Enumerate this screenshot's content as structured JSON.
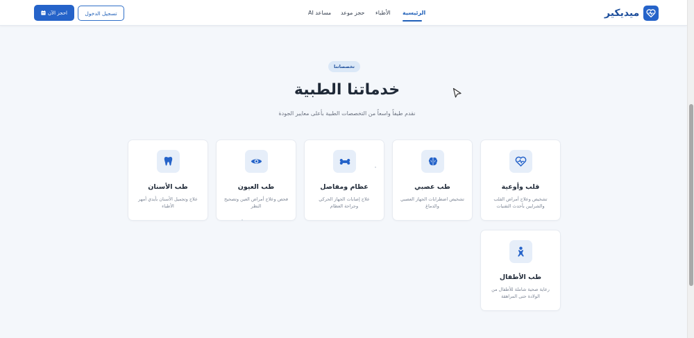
{
  "header": {
    "brand_name": "ميديكير",
    "nav": [
      "الرئيسية",
      "الأطباء",
      "حجز موعد",
      "مساعد AI"
    ],
    "login_label": "تسجيل الدخول",
    "book_label": "احجز الآن"
  },
  "section": {
    "pill": "تخصصاتنا",
    "title": "خدماتنا الطبية",
    "subtitle": "نقدم طيفاً واسعاً من التخصصات الطبية بأعلى معايير الجودة"
  },
  "cards": [
    {
      "title": "قلب وأوعية",
      "desc": "تشخيص وعلاج أمراض القلب والشرايين بأحدث التقنيات",
      "icon": "heart-pulse-icon"
    },
    {
      "title": "طب عصبي",
      "desc": "تشخيص اضطرابات الجهاز العصبي والدماغ",
      "icon": "brain-icon"
    },
    {
      "title": "عظام ومفاصل",
      "desc": "علاج إصابات الجهاز الحركي وجراحة العظام",
      "icon": "bone-icon"
    },
    {
      "title": "طب العيون",
      "desc": "فحص وعلاج أمراض العين وتصحيح النظر",
      "icon": "eye-icon"
    },
    {
      "title": "طب الأسنان",
      "desc": "علاج وتجميل الأسنان بأيدي أمهر الأطباء",
      "icon": "tooth-icon"
    },
    {
      "title": "طب الأطفال",
      "desc": "رعاية صحية شاملة للأطفال من الولادة حتى المراهقة",
      "icon": "baby-icon"
    }
  ],
  "colors": {
    "primary": "#2563c9",
    "icon_bg": "#e6eef9",
    "page_bg": "#f4f7fb"
  }
}
